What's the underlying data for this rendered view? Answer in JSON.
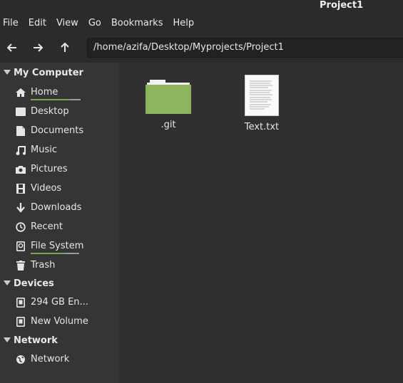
{
  "window": {
    "title": "Project1"
  },
  "menu": [
    "File",
    "Edit",
    "View",
    "Go",
    "Bookmarks",
    "Help"
  ],
  "toolbar": {
    "path": "/home/azifa/Desktop/Myprojects/Project1",
    "icons": [
      "back-arrow",
      "forward-arrow",
      "up-arrow"
    ]
  },
  "sidebar": {
    "sections": [
      {
        "label": "My Computer"
      },
      {
        "label": "Devices"
      },
      {
        "label": "Network"
      }
    ],
    "my_computer": [
      {
        "label": "Home",
        "icon": "home"
      },
      {
        "label": "Desktop",
        "icon": "desktop"
      },
      {
        "label": "Documents",
        "icon": "documents"
      },
      {
        "label": "Music",
        "icon": "music"
      },
      {
        "label": "Pictures",
        "icon": "camera"
      },
      {
        "label": "Videos",
        "icon": "film"
      },
      {
        "label": "Downloads",
        "icon": "download"
      },
      {
        "label": "Recent",
        "icon": "clock"
      },
      {
        "label": "File System",
        "icon": "drive"
      },
      {
        "label": "Trash",
        "icon": "trash"
      }
    ],
    "devices": [
      {
        "label": "294 GB En...",
        "icon": "disk"
      },
      {
        "label": "New Volume",
        "icon": "disk"
      }
    ],
    "network": [
      {
        "label": "Network",
        "icon": "network"
      }
    ],
    "usage_bars": {
      "home": 0.78,
      "file_system": 0.7
    }
  },
  "files": [
    {
      "name": ".git",
      "type": "folder",
      "color": "#8cb55d"
    },
    {
      "name": "Text.txt",
      "type": "text-file"
    }
  ],
  "colors": {
    "accent": "#8cb55d",
    "sidebar": "#353535",
    "main": "#303030"
  }
}
